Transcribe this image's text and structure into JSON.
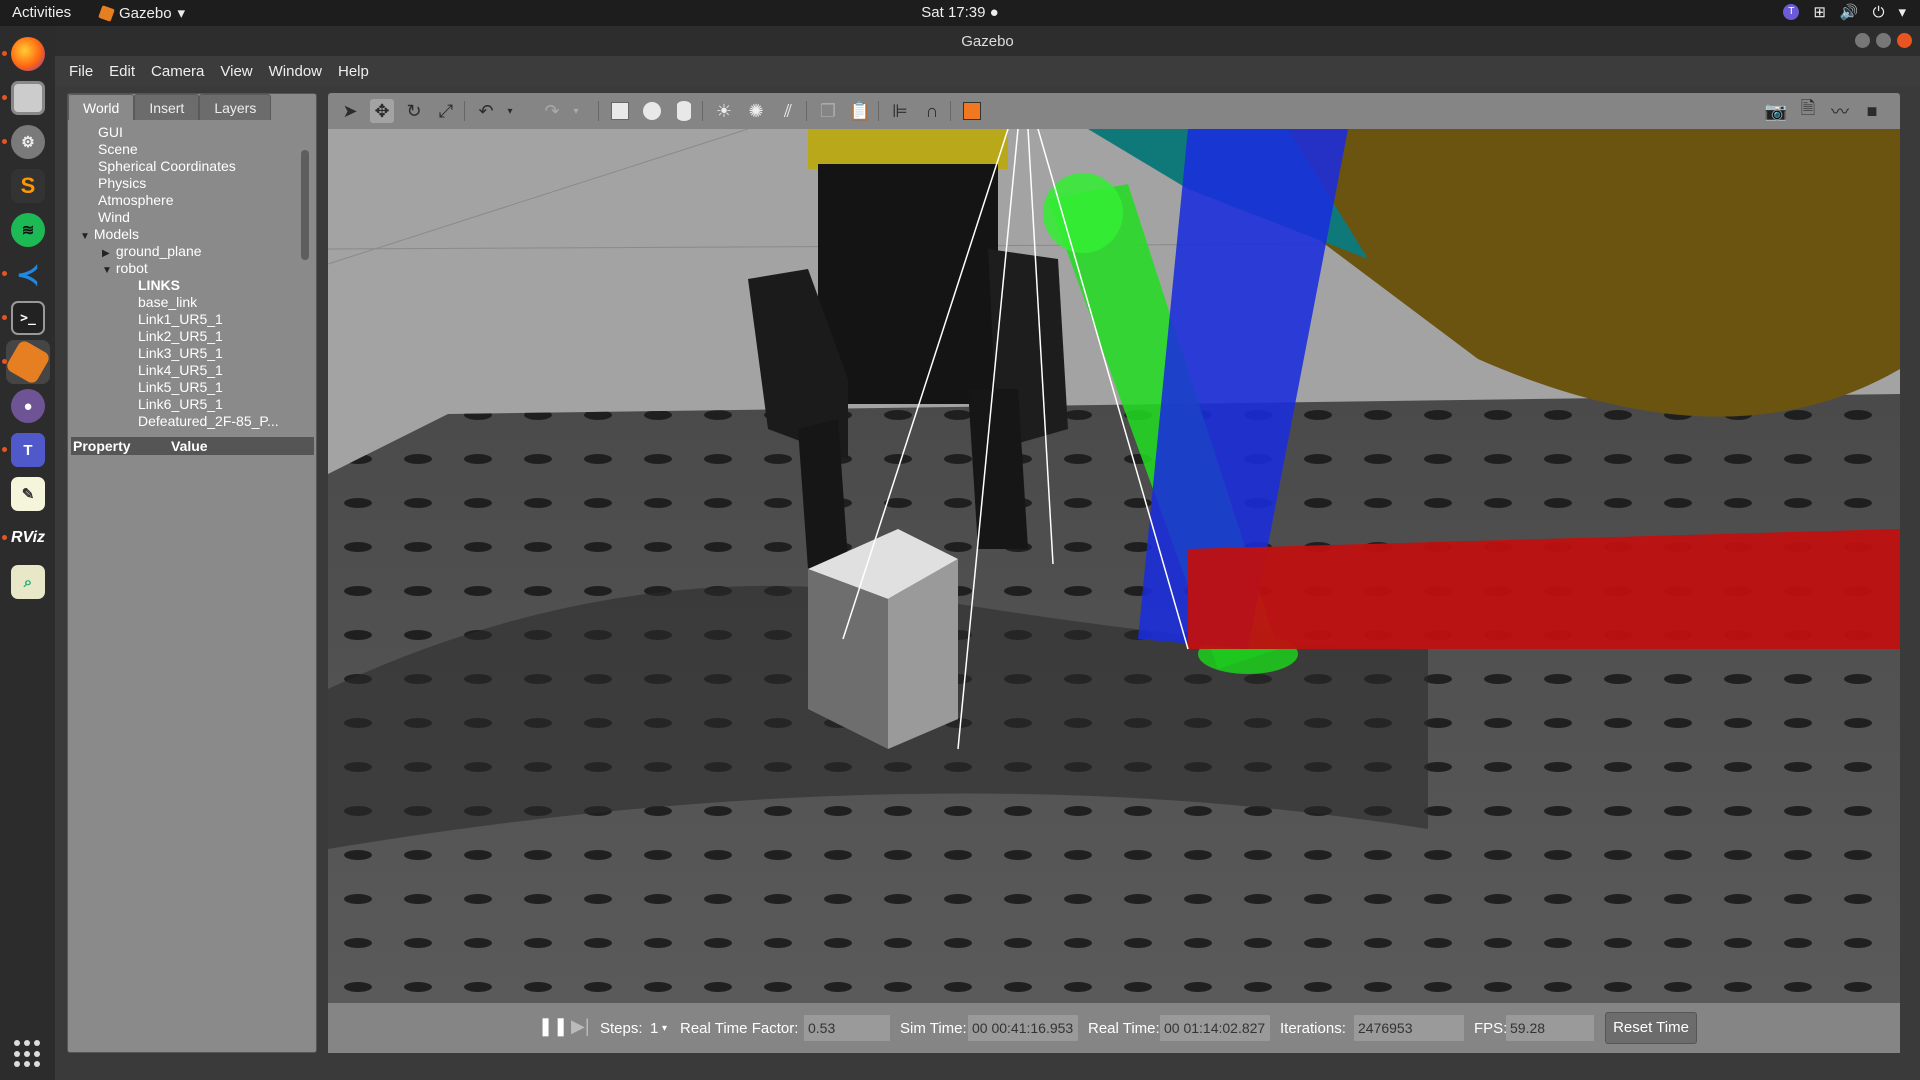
{
  "topbar": {
    "activities": "Activities",
    "app_name": "Gazebo",
    "clock": "Sat 17:39 ●",
    "tray_icons": [
      "teams-icon",
      "network-icon",
      "volume-icon",
      "power-icon",
      "chevron-down-icon"
    ]
  },
  "dock": {
    "apps": [
      "firefox",
      "files",
      "settings",
      "sublime-text",
      "spotify",
      "vscode",
      "terminal",
      "gazebo",
      "github",
      "teams",
      "text-editor",
      "rviz",
      "image-viewer"
    ],
    "rviz_label": "RViz",
    "teams_label": "T"
  },
  "window": {
    "title": "Gazebo"
  },
  "menu": {
    "file": "File",
    "edit": "Edit",
    "camera": "Camera",
    "view": "View",
    "window": "Window",
    "help": "Help"
  },
  "left_panel": {
    "tabs": [
      "World",
      "Insert",
      "Layers"
    ],
    "tree": {
      "gui": "GUI",
      "scene": "Scene",
      "spherical": "Spherical Coordinates",
      "physics": "Physics",
      "atmosphere": "Atmosphere",
      "wind": "Wind",
      "models": "Models",
      "ground_plane": "ground_plane",
      "robot": "robot",
      "links": "LINKS",
      "link_items": [
        "base_link",
        "Link1_UR5_1",
        "Link2_UR5_1",
        "Link3_UR5_1",
        "Link4_UR5_1",
        "Link5_UR5_1",
        "Link6_UR5_1",
        "Defeatured_2F-85_P..."
      ]
    },
    "property_header": "Property",
    "value_header": "Value"
  },
  "bottom": {
    "steps_label": "Steps:",
    "steps_value": "1",
    "rtf_label": "Real Time Factor:",
    "rtf_value": "0.53",
    "sim_label": "Sim Time:",
    "sim_value": "00 00:41:16.953",
    "real_label": "Real Time:",
    "real_value": "00 01:14:02.827",
    "iter_label": "Iterations:",
    "iter_value": "2476953",
    "fps_label": "FPS:",
    "fps_value": "59.28",
    "reset_label": "Reset Time"
  }
}
